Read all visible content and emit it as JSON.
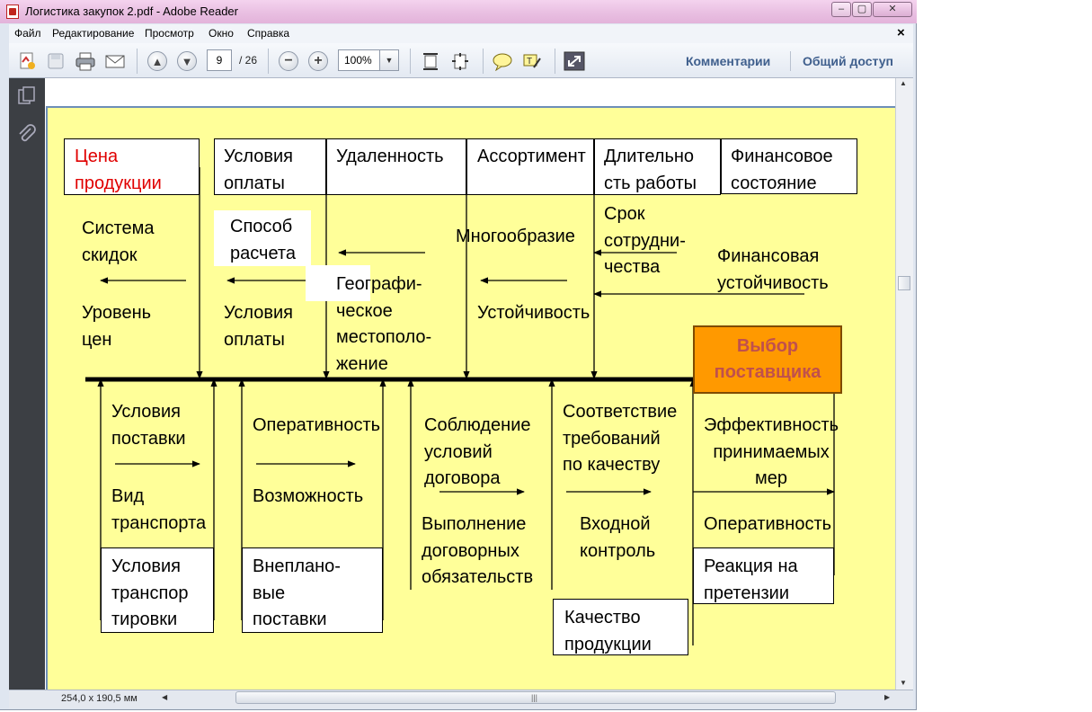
{
  "window": {
    "title": "Логистика закупок 2.pdf - Adobe Reader",
    "close_glyph": "✕"
  },
  "menu": {
    "items": [
      "Файл",
      "Редактирование",
      "Просмотр",
      "Окно",
      "Справка"
    ],
    "close_doc": "×"
  },
  "toolbar": {
    "page_current": "9",
    "page_total": "/ 26",
    "zoom": "100%",
    "comments_label": "Комментарии",
    "share_label": "Общий доступ"
  },
  "status": {
    "page_size": "254,0 x 190,5 мм"
  },
  "slide": {
    "top_headers": [
      {
        "text": "Цена\nпродукции",
        "color": "#e00000"
      },
      {
        "text": "Условия\nоплаты"
      },
      {
        "text": "Удаленность"
      },
      {
        "text": "Ассортимент"
      },
      {
        "text": "Длительно\nсть работы"
      },
      {
        "text": "Финансовое\nсостояние"
      }
    ],
    "upper_causes": {
      "c1": "Система\nскидок",
      "c2": "Уровень\nцен",
      "c3": "Способ\nрасчета",
      "c4": "Условия\nоплаты",
      "c5": "Географи-\nческое\nместополо-\nжение",
      "c6": "Многообразие",
      "c7": "Устойчивость",
      "c8": "Срок\nсотрудни-\nчества",
      "c9": "Финансовая\nустойчивость"
    },
    "effect": {
      "text": "Выбор\nпоставщика",
      "color": "#c0504d",
      "fill": "#ff9900"
    },
    "lower_causes": {
      "d1": "Условия\nпоставки",
      "d2": "Вид\nтранспорта",
      "d3": "Оперативность",
      "d4": "Возможность",
      "d5": "Соблюдение\nусловий\nдоговора",
      "d6": "Выполнение\nдоговорных\nобязательств",
      "d7": "Соответствие\nтребований\nпо качеству",
      "d8": "Входной\nконтроль",
      "d9": "Эффективность\nпринимаемых\nмер",
      "d10": "Оперативность"
    },
    "bottom_headers": [
      "Условия\nтранспор\nтировки",
      "Внеплано-\nвые\nпоставки",
      "Качество\nпродукции",
      "Реакция на\nпретензии"
    ]
  },
  "colors": {
    "slide_bg": "#ffff99",
    "title_bar": "#e9bfe2",
    "effect_fill": "#ff9900",
    "effect_text": "#c0504d",
    "header_red": "#e00000",
    "toolbar_link": "#3f5f8d"
  }
}
